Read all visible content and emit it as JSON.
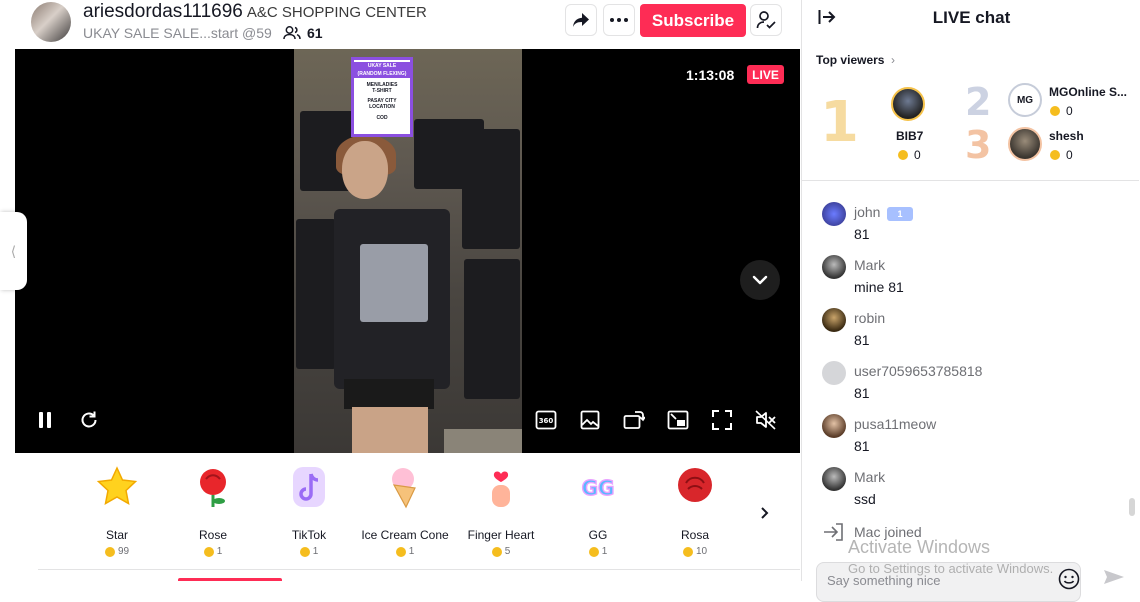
{
  "header": {
    "host_username": "ariesdordas111696",
    "host_nickname": "A&C SHOPPING CENTER",
    "stream_title": "UKAY SALE SALE...start @59",
    "viewer_count": "61",
    "subscribe_label": "Subscribe"
  },
  "video": {
    "live_duration": "1:13:08",
    "live_badge": "LIVE",
    "sign": {
      "line1": "UKAY SALE",
      "line2": "(RANDOM FLEXING)",
      "line3": "MEN/LADIES",
      "line4": "T-SHIRT",
      "line5": "PASAY CITY",
      "line6": "LOCATION",
      "line7": "COD"
    },
    "controls": [
      "pause-icon",
      "refresh-icon",
      "360-icon",
      "picture-icon",
      "rotate-icon",
      "pip-icon",
      "fullscreen-icon",
      "mute-icon"
    ]
  },
  "gifts": [
    {
      "name": "Star",
      "price": "99",
      "color": "#ffd21e"
    },
    {
      "name": "Rose",
      "price": "1",
      "color": "#e8262b"
    },
    {
      "name": "TikTok",
      "price": "1",
      "color": "#c9a6ff"
    },
    {
      "name": "Ice Cream Cone",
      "price": "1",
      "color": "#ffc0d6"
    },
    {
      "name": "Finger Heart",
      "price": "5",
      "color": "#ffb49a"
    },
    {
      "name": "GG",
      "price": "1",
      "color": "#5ab8ff"
    },
    {
      "name": "Rosa",
      "price": "10",
      "color": "#d8262b"
    }
  ],
  "chat": {
    "title": "LIVE chat",
    "top_viewers_label": "Top viewers",
    "top_viewers": [
      {
        "rank": "1",
        "name": "BIB7",
        "coins": "0"
      },
      {
        "rank": "2",
        "name": "MGOnline S...",
        "coins": "0",
        "avatar_text": "MG"
      },
      {
        "rank": "3",
        "name": "shesh",
        "coins": "0"
      }
    ],
    "messages": [
      {
        "user": "john",
        "text": "81",
        "badge": "1"
      },
      {
        "user": "Mark",
        "text": "mine 81"
      },
      {
        "user": "robin",
        "text": "81"
      },
      {
        "user": "user7059653785818",
        "text": "81"
      },
      {
        "user": "pusa11meow",
        "text": "81"
      },
      {
        "user": "Mark",
        "text": "ssd"
      }
    ],
    "joined": "Mac joined",
    "input_placeholder": "Say something nice"
  },
  "watermark": {
    "title": "Activate Windows",
    "subtitle": "Go to Settings to activate Windows."
  },
  "colors": {
    "brand": "#fe2c55",
    "text": "#161823",
    "muted": "#8a8b91"
  }
}
